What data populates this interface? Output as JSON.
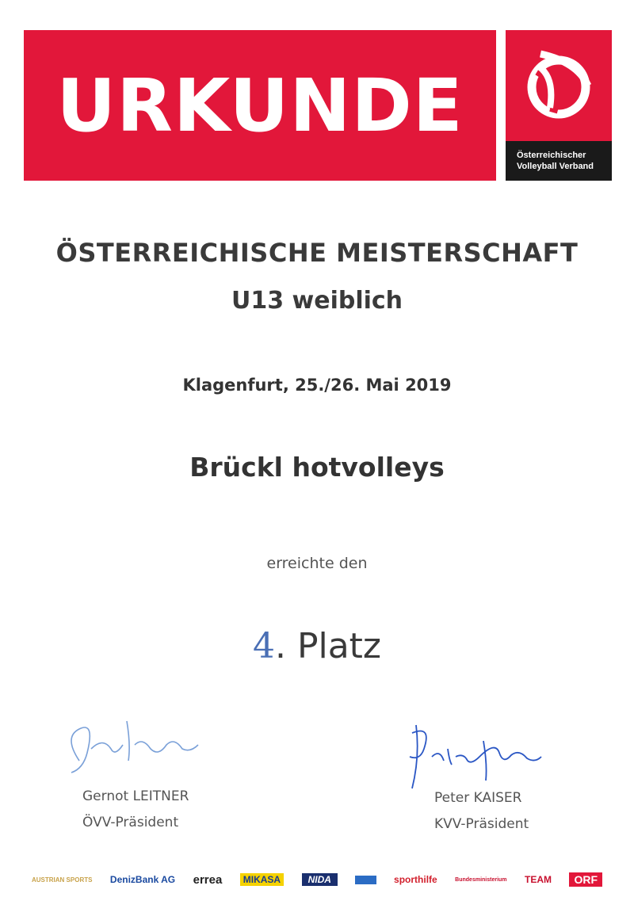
{
  "header": {
    "title": "URKUNDE",
    "logo_text_line1": "Österreichischer",
    "logo_text_line2": "Volleyball Verband"
  },
  "event": {
    "title": "ÖSTERREICHISCHE MEISTERSCHAFT",
    "category": "U13 weiblich",
    "location_date": "Klagenfurt, 25./26. Mai 2019"
  },
  "award": {
    "team": "Brückl hotvolleys",
    "achieved_text": "erreichte den",
    "rank_number": "4",
    "rank_suffix": ". Platz"
  },
  "signatures": [
    {
      "name": "Gernot LEITNER",
      "role": "ÖVV-Präsident"
    },
    {
      "name": "Peter KAISER",
      "role": "KVV-Präsident"
    }
  ],
  "sponsors": [
    {
      "label": "AUSTRIAN SPORTS",
      "color": "#c8a24a"
    },
    {
      "label": "DenizBank AG",
      "color": "#1b4aa0"
    },
    {
      "label": "errea",
      "color": "#222222"
    },
    {
      "label": "MIKASA",
      "color": "#1a3c8c"
    },
    {
      "label": "NIDA",
      "color": "#1a2f6e"
    },
    {
      "label": "sporthilfe",
      "color": "#d21f2c"
    },
    {
      "label": "Bundesministerium",
      "color": "#c8102e"
    },
    {
      "label": "TEAM",
      "color": "#c8102e"
    },
    {
      "label": "ORF",
      "color": "#e2173a"
    }
  ],
  "colors": {
    "brand_red": "#e2173a",
    "ink_blue": "#4a6fb5"
  }
}
